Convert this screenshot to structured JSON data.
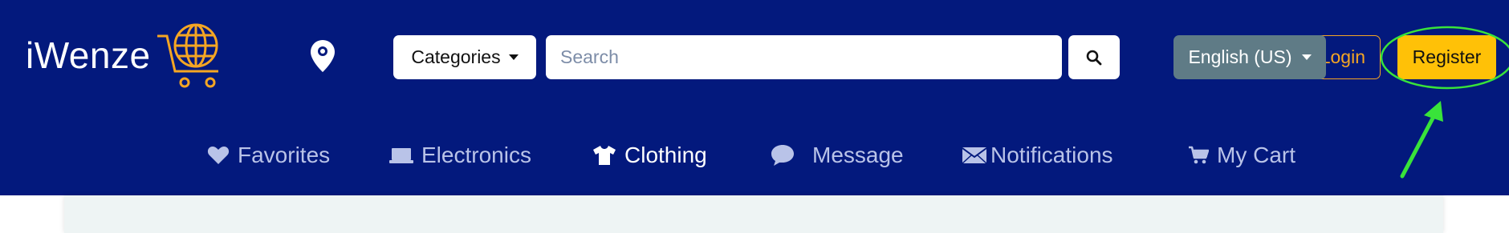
{
  "brand": {
    "name": "iWenze"
  },
  "header": {
    "categories_label": "Categories",
    "search_placeholder": "Search",
    "language_label": "English (US)",
    "login_label": "Login",
    "register_label": "Register"
  },
  "nav": {
    "items": [
      {
        "label": "Favorites",
        "icon": "heart-icon"
      },
      {
        "label": "Electronics",
        "icon": "laptop-icon"
      },
      {
        "label": "Clothing",
        "icon": "shirt-icon"
      },
      {
        "label": "Message",
        "icon": "chat-bubble-icon"
      },
      {
        "label": "Notifications",
        "icon": "envelope-icon"
      },
      {
        "label": "My Cart",
        "icon": "cart-icon"
      }
    ]
  },
  "colors": {
    "navbar_bg": "#03197d",
    "accent_orange": "#f5a623",
    "register_yellow": "#ffc107",
    "language_btn": "#5f7b86",
    "annotation_green": "#39e33a"
  }
}
